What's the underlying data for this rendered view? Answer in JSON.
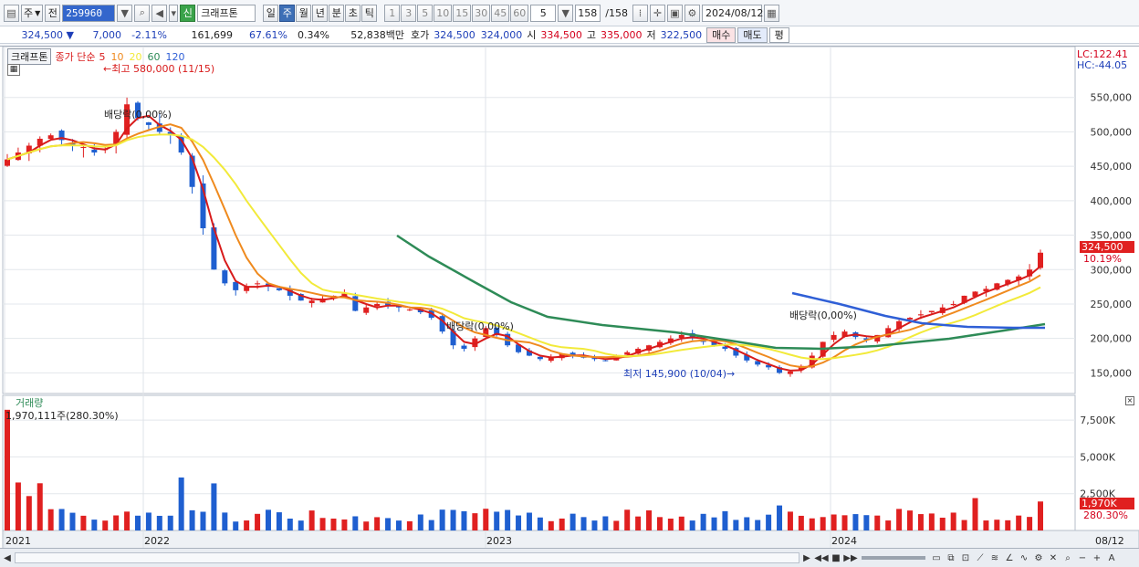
{
  "toolbar": {
    "market_type": "주",
    "prev_label": "전",
    "stock_code": "259960",
    "new_badge": "신",
    "stock_name": "크래프톤",
    "periods": [
      "일",
      "주",
      "월",
      "년",
      "분",
      "초",
      "틱"
    ],
    "active_period": "주",
    "intervals": [
      "1",
      "3",
      "5",
      "10",
      "15",
      "30",
      "45",
      "60"
    ],
    "interval_value": "5",
    "count_display": "158",
    "count_total": "/158",
    "date_value": "2024/08/12"
  },
  "quote": {
    "price": "324,500",
    "change": "7,000",
    "change_pct": "-2.11%",
    "volume": "161,699",
    "volume_ratio": "67.61%",
    "turnover": "0.34%",
    "amount": "52,838백만",
    "hoga_label": "호가",
    "ask": "324,500",
    "bid": "324,000",
    "open_label": "시",
    "open": "334,500",
    "high_label": "고",
    "high": "335,000",
    "low_label": "저",
    "low": "322,500",
    "buy_label": "매수",
    "sell_label": "매도",
    "eval_label": "평"
  },
  "chart": {
    "title_tag": "크래프톤",
    "legend_prefix": "종가 단순",
    "ma_periods": [
      "5",
      "10",
      "20",
      "60",
      "120"
    ],
    "ma_colors": [
      "#d81b1b",
      "#ef8a1e",
      "#f2ea3a",
      "#2e8b57",
      "#2f5fd6"
    ],
    "annotation_high": "최고 580,000 (11/15)",
    "annotation_low": "최저 145,900 (10/04)",
    "dividend_label": "배당락(0,00%)",
    "lc_label": "LC:122.41",
    "hc_label": "HC:-44.05",
    "current_price_tag": "324,500",
    "current_pct_tag": "10.19%",
    "price_ticks": [
      "550,000",
      "500,000",
      "450,000",
      "400,000",
      "350,000",
      "300,000",
      "250,000",
      "200,000",
      "150,000"
    ],
    "volume_title": "거래량",
    "volume_value": "1,970,111주(280.30%)",
    "volume_ticks": [
      "7,500K",
      "5,000K",
      "2,500K"
    ],
    "volume_tag": "1,970K",
    "volume_pct_tag": "280.30%",
    "x_labels": [
      "2021",
      "2022",
      "2023",
      "2024"
    ],
    "x_end_label": "08/12",
    "up_color": "#e02020",
    "down_color": "#1f5fd0"
  },
  "chart_data": {
    "type": "candlestick",
    "period": "weekly",
    "symbol": "크래프톤",
    "x_range": [
      "2021-08",
      "2024-08-12"
    ],
    "ylim": [
      120000,
      600000
    ],
    "close_path": [
      460000,
      470000,
      480000,
      490000,
      495000,
      488000,
      480000,
      478000,
      470000,
      475000,
      500000,
      540000,
      520000,
      510000,
      500000,
      495000,
      470000,
      420000,
      360000,
      300000,
      280000,
      270000,
      275000,
      280000,
      275000,
      270000,
      262000,
      255000,
      255000,
      258000,
      262000,
      265000,
      240000,
      245000,
      250000,
      248000,
      245000,
      242000,
      238000,
      230000,
      210000,
      190000,
      185000,
      200000,
      215000,
      205000,
      190000,
      180000,
      175000,
      170000,
      172000,
      178000,
      176000,
      172000,
      170000,
      168000,
      175000,
      180000,
      185000,
      190000,
      195000,
      200000,
      205000,
      200000,
      195000,
      190000,
      185000,
      175000,
      168000,
      162000,
      158000,
      150000,
      152000,
      160000,
      175000,
      195000,
      205000,
      210000,
      202000,
      198000,
      205000,
      215000,
      225000,
      230000,
      235000,
      240000,
      245000,
      250000,
      262000,
      268000,
      272000,
      280000,
      285000,
      290000,
      300000,
      324500
    ],
    "volume_current": 1970111,
    "volume_ticks_k": [
      2500,
      5000,
      7500
    ]
  }
}
